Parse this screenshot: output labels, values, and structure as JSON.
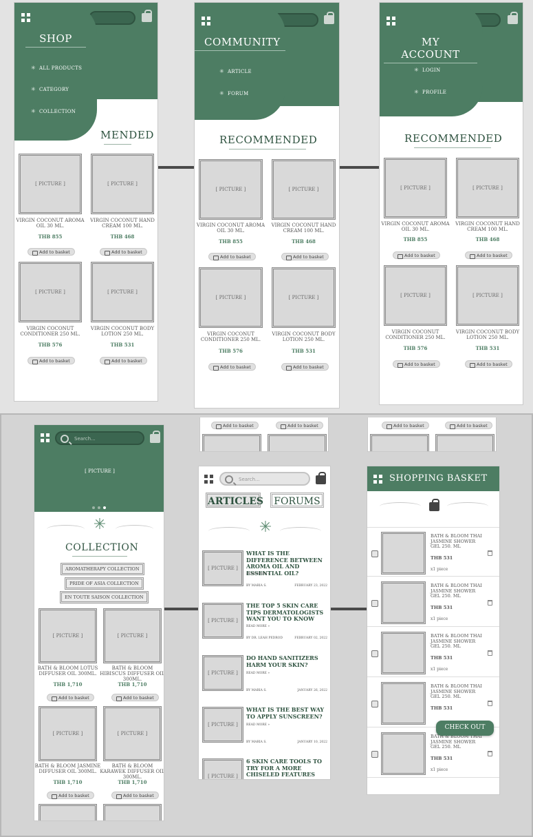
{
  "menus": {
    "shop": {
      "title": "SHOP",
      "items": [
        "ALL PRODUCTS",
        "CATEGORY",
        "COLLECTION"
      ]
    },
    "community": {
      "title": "COMMUNITY",
      "items": [
        "ARTICLE",
        "FORUM"
      ]
    },
    "account": {
      "title": "MY ACCOUNT",
      "items": [
        "LOGIN",
        "PROFILE"
      ]
    }
  },
  "shop_partial_title": "MENDED",
  "recommended": {
    "title": "RECOMMENDED",
    "picture": "[ PICTURE ]",
    "add_label": "Add to basket",
    "products": [
      {
        "name": "VIRGIN COCONUT AROMA OIL 30 ML.",
        "price": "THB 855"
      },
      {
        "name": "VIRGIN COCONUT HAND CREAM 100 ML.",
        "price": "THB 468"
      },
      {
        "name": "VIRGIN COCONUT CONDITIONER 250 ML.",
        "price": "THB 576"
      },
      {
        "name": "VIRGIN COCONUT BODY LOTION 250 ML.",
        "price": "THB 531"
      }
    ]
  },
  "collection_screen": {
    "search_placeholder": "Search...",
    "hero_picture": "[ PICTURE ]",
    "title": "COLLECTION",
    "tags": [
      "AROMATHERAPY COLLECTION",
      "PRIDE OF ASIA COLLECTION",
      "EN TOUTE SAISON COLLECTION"
    ],
    "picture": "[ PICTURE ]",
    "add_label": "Add to basket",
    "products": [
      {
        "name": "BATH & BLOOM LOTUS DIFFUSER OIL 300ML.",
        "price": "THB 1,710"
      },
      {
        "name": "BATH & BLOOM HIBISCUS DIFFUSER OIL 300ML.",
        "price": "THB 1,710"
      },
      {
        "name": "BATH & BLOOM JASMINE DIFFUSER OIL 300ML.",
        "price": "THB 1,710"
      },
      {
        "name": "BATH & BLOOM KARAWEK DIFFUSER OIL 300ML.",
        "price": "THB 1,710"
      }
    ]
  },
  "articles_screen": {
    "search_placeholder": "Search...",
    "tab_articles": "ARTICLES",
    "tab_forums": "FORUMS",
    "picture": "[ PICTURE ]",
    "read_more": "READ MORE »",
    "add_label": "Add to basket",
    "articles": [
      {
        "title": "WHAT IS THE DIFFERENCE BETWEEN AROMA OIL AND ESSENTIAL OIL?",
        "author": "BY MARIA S.",
        "date": "FEBRUARY 23, 2022"
      },
      {
        "title": "THE TOP 5 SKIN CARE TIPS DERMATOLOGISTS WANT YOU TO KNOW",
        "author": "BY DR. LEAH PEDROD",
        "date": "FEBRUARY 02, 2022"
      },
      {
        "title": "DO HAND SANITIZERS HARM YOUR SKIN?",
        "author": "BY MARIA S.",
        "date": "JANUARY 26, 2022"
      },
      {
        "title": "WHAT IS THE BEST WAY TO APPLY SUNSCREEN?",
        "author": "BY MARIA S.",
        "date": "JANUARY 10, 2022"
      },
      {
        "title": "6 SKIN CARE TOOLS TO TRY FOR A MORE CHISELED FEATURES",
        "author": "",
        "date": ""
      }
    ]
  },
  "basket_screen": {
    "title": "SHOPPING BASKET",
    "checkout": "CHECK OUT",
    "add_label": "Add to basket",
    "items": [
      {
        "name": "BATH & BLOOM THAI JASMINE SHOWER GEL 250. ML",
        "price": "THB 531",
        "qty": "x1 piece"
      },
      {
        "name": "BATH & BLOOM THAI JASMINE SHOWER GEL 250. ML",
        "price": "THB 531",
        "qty": "x1 piece"
      },
      {
        "name": "BATH & BLOOM THAI JASMINE SHOWER GEL 250. ML",
        "price": "THB 531",
        "qty": "x1 piece"
      },
      {
        "name": "BATH & BLOOM THAI JASMINE SHOWER GEL 250. ML",
        "price": "THB 531",
        "qty": ""
      },
      {
        "name": "BATH & BLOOM THAI JASMINE SHOWER GEL 250. ML",
        "price": "THB 531",
        "qty": "x1 piece"
      }
    ]
  },
  "colors": {
    "brand_green": "#4d7d63",
    "dark_green": "#2f5340",
    "picture_gray": "#d9d9d9"
  }
}
